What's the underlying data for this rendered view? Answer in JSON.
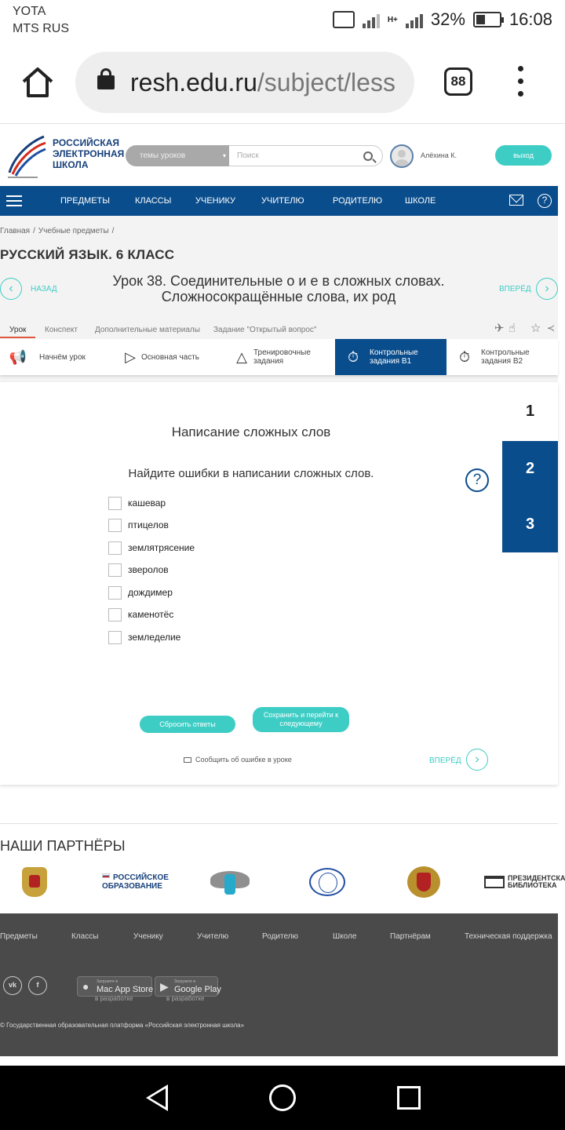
{
  "status_bar": {
    "carrier_1": "YOTA",
    "carrier_2": "MTS RUS",
    "network": "H+",
    "battery": "32%",
    "time": "16:08"
  },
  "browser": {
    "url_domain": "resh.edu.ru",
    "url_path": "/subject/less",
    "tab_count": "88"
  },
  "site_header": {
    "logo_line_1": "РОССИЙСКАЯ",
    "logo_line_2": "ЭЛЕКТРОННАЯ",
    "logo_line_3": "ШКОЛА",
    "topic_select": "темы уроков",
    "search_placeholder": "Поиск",
    "username": "Алёхина К.",
    "logout": "выход"
  },
  "nav": {
    "items": [
      "ПРЕДМЕТЫ",
      "КЛАССЫ",
      "УЧЕНИКУ",
      "УЧИТЕЛЮ",
      "РОДИТЕЛЮ",
      "ШКОЛЕ"
    ]
  },
  "lesson": {
    "breadcrumb": [
      "Главная",
      "/",
      "Учебные предметы",
      "/"
    ],
    "course_title": "РУССКИЙ ЯЗЫК. 6 КЛАСС",
    "back": "НАЗАД",
    "forward": "ВПЕРЁД",
    "title_line_1": "Урок 38. Соединительные о и е в сложных словах.",
    "title_line_2": "Сложносокращённые слова, их род",
    "tabs": [
      "Урок",
      "Конспект",
      "Дополнительные материалы",
      "Задание \"Открытый вопрос\""
    ],
    "steps": [
      {
        "label_1": "Начнём урок",
        "label_2": ""
      },
      {
        "label_1": "Основная часть",
        "label_2": ""
      },
      {
        "label_1": "Тренировочные",
        "label_2": "задания"
      },
      {
        "label_1": "Контрольные",
        "label_2": "задания В1"
      },
      {
        "label_1": "Контрольные",
        "label_2": "задания В2"
      }
    ]
  },
  "task": {
    "title": "Написание сложных слов",
    "instruction": "Найдите ошибки в написании сложных слов.",
    "numbers": [
      "1",
      "2",
      "3"
    ],
    "options": [
      "кашевар",
      "птицелов",
      "землятрясение",
      "зверолов",
      "дождимер",
      "каменотёс",
      "земледелие"
    ],
    "reset": "Сбросить ответы",
    "save_line_1": "Сохранить и перейти к",
    "save_line_2": "следующему",
    "report": "Сообщить об ошибке в уроке",
    "forward": "ВПЕРЁД"
  },
  "partners": {
    "title": "НАШИ ПАРТНЁРЫ",
    "ro_line_1": "РОССИЙСКОЕ",
    "ro_line_2": "ОБРАЗОВАНИЕ",
    "lib_line_1": "ПРЕЗИДЕНТСКАЯ",
    "lib_line_2": "БИБЛИОТЕКА"
  },
  "footer": {
    "links": [
      "Предметы",
      "Классы",
      "Ученику",
      "Учителю",
      "Родителю",
      "Школе",
      "Партнёрам",
      "Техническая поддержка"
    ],
    "app_store_small": "Загрузите в",
    "app_store": "Mac App Store",
    "google_small": "Загрузите в",
    "google_play": "Google Play",
    "in_dev": "в разработке",
    "copyright": "© Государственная образовательная платформа «Российская электронная школа»"
  },
  "colors": {
    "brand_blue": "#0a4d8c",
    "accent_teal": "#3ecdc5",
    "footer_gray": "#4a4a4a"
  }
}
